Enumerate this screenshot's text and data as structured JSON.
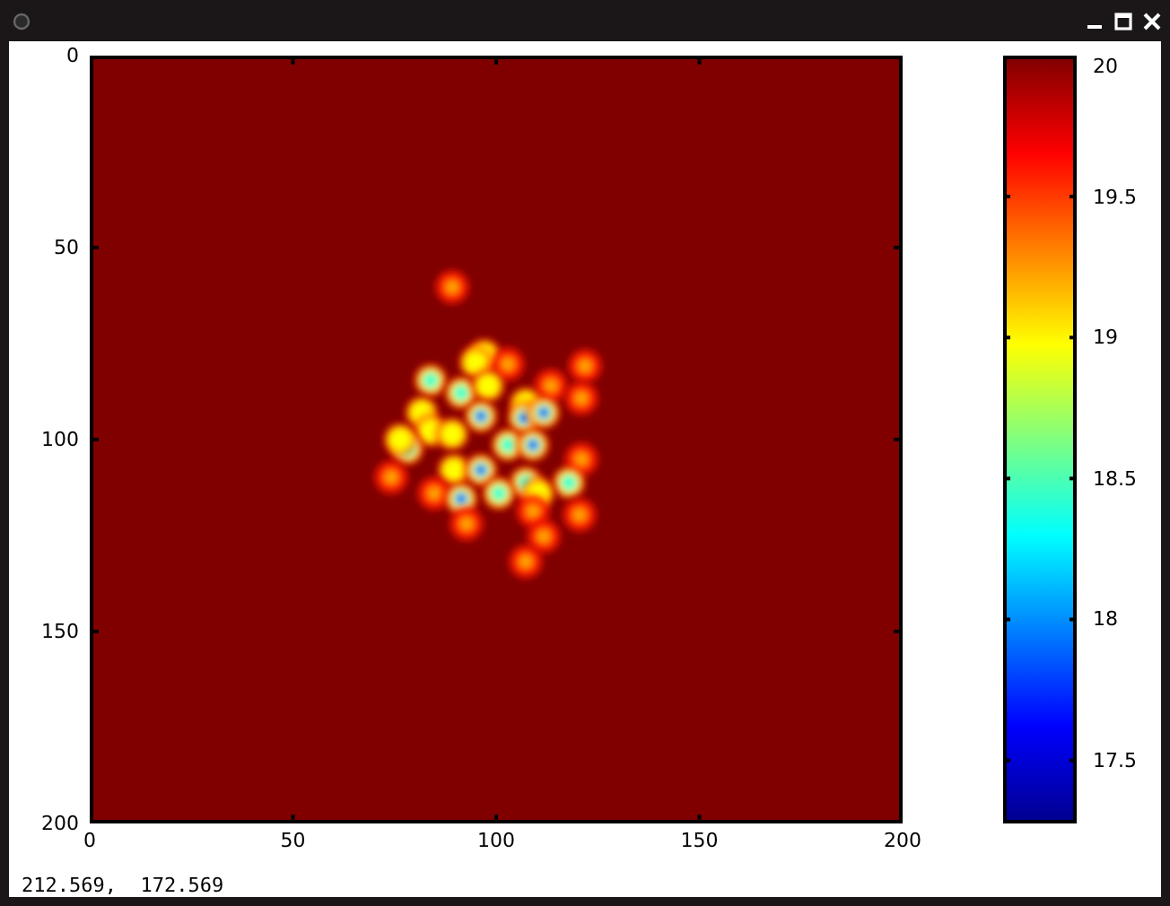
{
  "plot": {
    "x_ticks": [
      "0",
      "50",
      "100",
      "150",
      "200"
    ],
    "y_ticks": [
      "0",
      "50",
      "100",
      "150",
      "200"
    ],
    "colorbar": {
      "ticks": [
        "20",
        "19.5",
        "19",
        "18.5",
        "18",
        "17.5"
      ]
    }
  },
  "status_bar": {
    "coordinates": "212.569,  172.569"
  }
}
